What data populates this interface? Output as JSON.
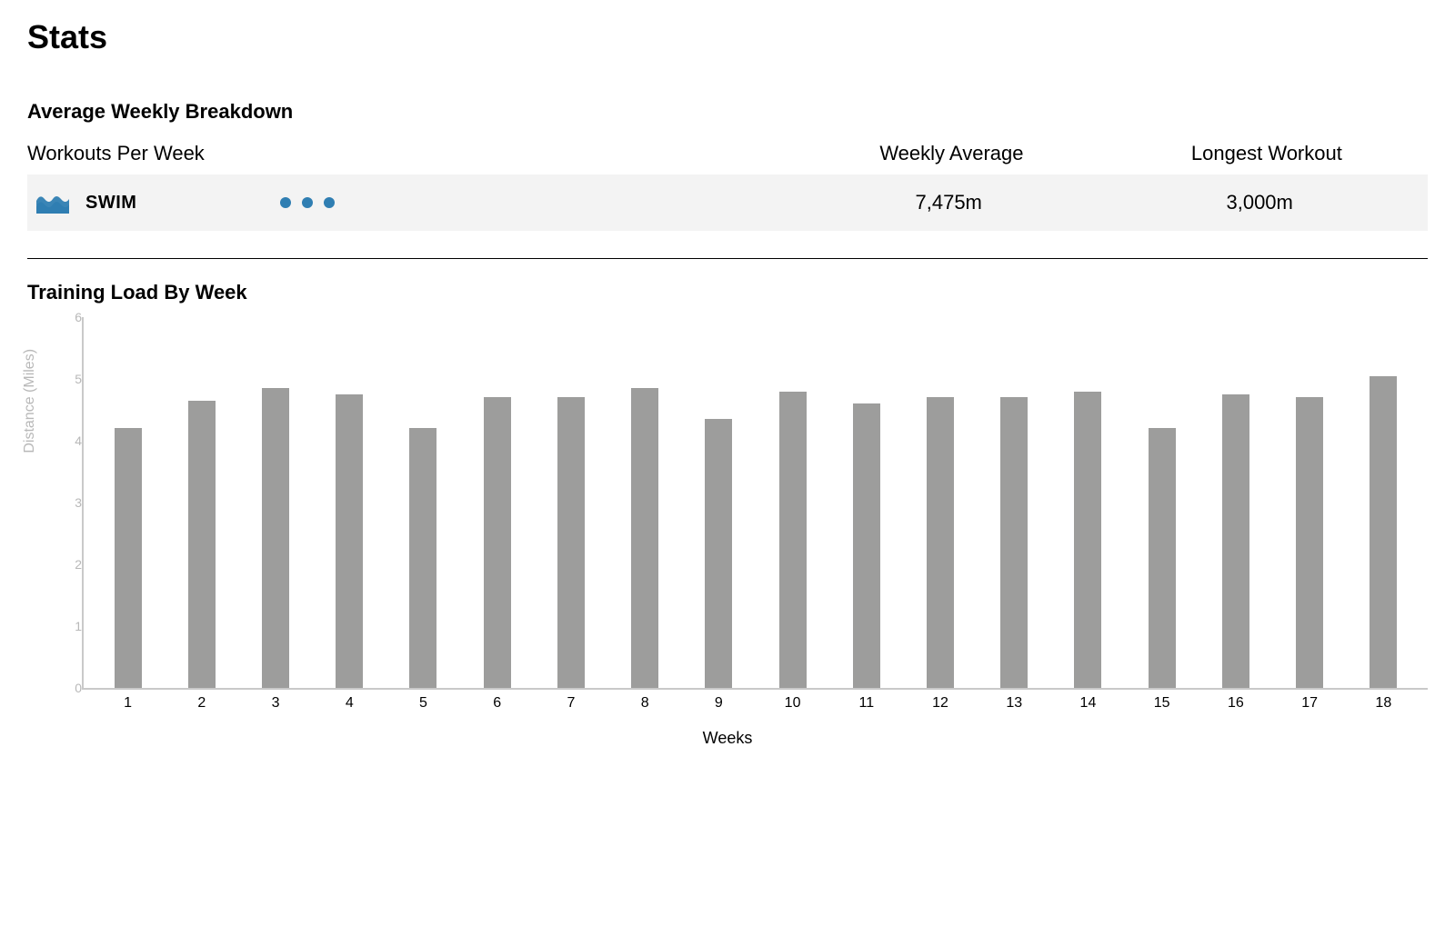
{
  "page": {
    "title": "Stats"
  },
  "breakdown": {
    "section_title": "Average Weekly Breakdown",
    "columns": {
      "workouts": "Workouts Per Week",
      "weekly_avg": "Weekly Average",
      "longest": "Longest Workout"
    },
    "row": {
      "activity": "SWIM",
      "dot_count": 3,
      "weekly_avg": "7,475m",
      "longest": "3,000m"
    }
  },
  "load": {
    "section_title": "Training Load By Week"
  },
  "chart_data": {
    "type": "bar",
    "title": "Training Load By Week",
    "xlabel": "Weeks",
    "ylabel": "Distance (Miles)",
    "ylim": [
      0,
      6
    ],
    "yticks": [
      0,
      1,
      2,
      3,
      4,
      5,
      6
    ],
    "categories": [
      "1",
      "2",
      "3",
      "4",
      "5",
      "6",
      "7",
      "8",
      "9",
      "10",
      "11",
      "12",
      "13",
      "14",
      "15",
      "16",
      "17",
      "18"
    ],
    "values": [
      4.2,
      4.65,
      4.85,
      4.75,
      4.2,
      4.7,
      4.7,
      4.85,
      4.35,
      4.8,
      4.6,
      4.7,
      4.7,
      4.8,
      4.2,
      4.75,
      4.7,
      5.05
    ]
  }
}
